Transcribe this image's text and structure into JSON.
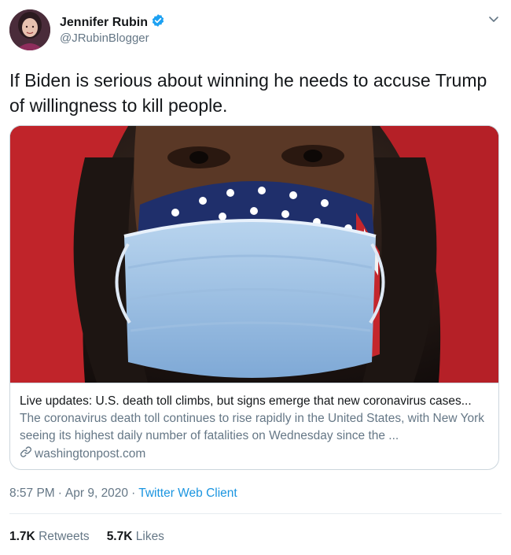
{
  "author": {
    "name": "Jennifer Rubin",
    "handle": "@JRubinBlogger",
    "verified": true,
    "verified_color": "#1da1f2"
  },
  "tweet": {
    "text": "If Biden is serious about winning he needs to accuse Trump of willingness to kill people."
  },
  "card": {
    "image_icon": "masked-person-photo",
    "title": "Live updates: U.S. death toll climbs, but signs emerge that new coronavirus cases...",
    "description": "The coronavirus death toll continues to rise rapidly in the United States, with New York seeing its highest daily number of fatalities on Wednesday since the ...",
    "link_icon": "link-icon",
    "domain": "washingtonpost.com"
  },
  "meta": {
    "time": "8:57 PM",
    "separator": "·",
    "date": "Apr 9, 2020",
    "client": "Twitter Web Client"
  },
  "stats": {
    "retweets_count": "1.7K",
    "retweets_label": "Retweets",
    "likes_count": "5.7K",
    "likes_label": "Likes"
  },
  "colors": {
    "text": "#14171a",
    "secondary": "#657786",
    "link": "#1b95e0",
    "border": "#ccd6dd"
  }
}
